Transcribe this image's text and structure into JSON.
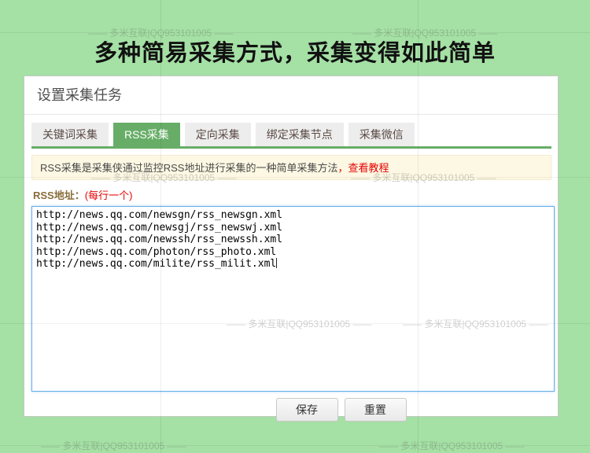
{
  "page": {
    "title": "多种简易采集方式，采集变得如此简单"
  },
  "watermark": {
    "text": "—— 多米互联|QQ953101005 ——"
  },
  "panel": {
    "header": "设置采集任务",
    "tabs": [
      {
        "label": "关键词采集",
        "active": false
      },
      {
        "label": "RSS采集",
        "active": true
      },
      {
        "label": "定向采集",
        "active": false
      },
      {
        "label": "绑定采集节点",
        "active": false
      },
      {
        "label": "采集微信",
        "active": false
      }
    ],
    "notice": {
      "text": "RSS采集是采集侠通过监控RSS地址进行采集的一种简单采集方法",
      "separator": "，",
      "link": "查看教程"
    },
    "form": {
      "label": "RSS地址：",
      "hint": "(每行一个)",
      "rss_urls": [
        "http://news.qq.com/newsgn/rss_newsgn.xml",
        "http://news.qq.com/newsgj/rss_newswj.xml",
        "http://news.qq.com/newssh/rss_newssh.xml",
        "http://news.qq.com/photon/rss_photo.xml",
        "http://news.qq.com/milite/rss_milit.xml"
      ]
    },
    "buttons": {
      "save": "保存",
      "reset": "重置"
    }
  },
  "colors": {
    "page_background": "#a5e0a5",
    "accent_green": "#67ad67",
    "notice_background": "#fdf8e3",
    "link_red": "#e60000",
    "label_brown": "#8a6d3b",
    "textarea_focus_blue": "#66afe9"
  }
}
